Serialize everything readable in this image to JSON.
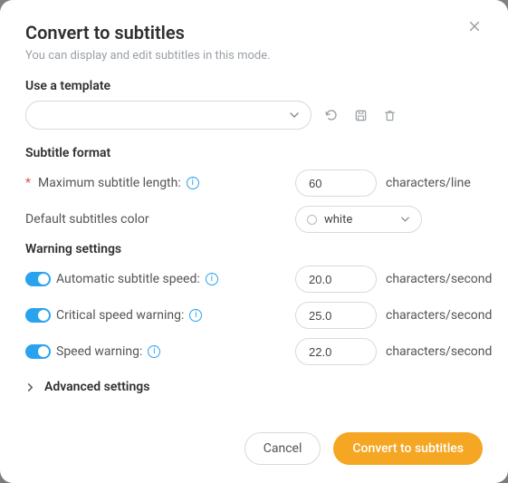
{
  "header": {
    "title": "Convert to subtitles",
    "subtitle": "You can display and edit subtitles in this mode."
  },
  "template": {
    "section_label": "Use a template",
    "selected": ""
  },
  "subtitle_format": {
    "section_label": "Subtitle format",
    "max_length_label": "Maximum subtitle length:",
    "max_length_value": "60",
    "max_length_unit": "characters/line",
    "color_label": "Default subtitles color",
    "color_value": "white"
  },
  "warning_settings": {
    "section_label": "Warning settings",
    "auto_speed_label": "Automatic subtitle speed:",
    "auto_speed_value": "20.0",
    "auto_speed_unit": "characters/second",
    "critical_label": "Critical speed warning:",
    "critical_value": "25.0",
    "critical_unit": "characters/second",
    "speed_label": "Speed warning:",
    "speed_value": "22.0",
    "speed_unit": "characters/second"
  },
  "advanced": {
    "label": "Advanced settings"
  },
  "footer": {
    "cancel": "Cancel",
    "confirm": "Convert to subtitles"
  }
}
